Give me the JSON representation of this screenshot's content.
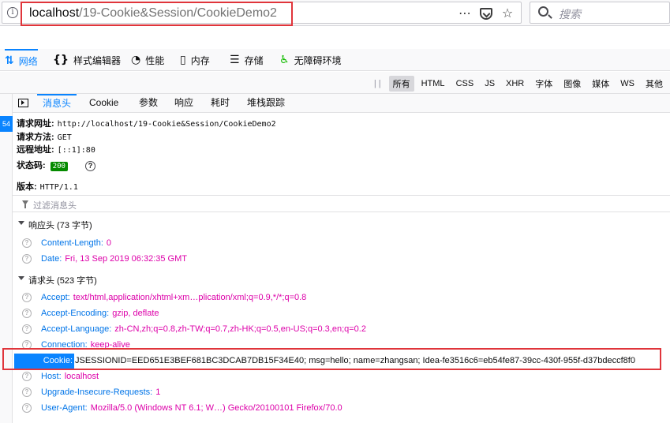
{
  "url_bar": {
    "host": "localhost",
    "path": "/19-Cookie&Session/CookieDemo2",
    "search_placeholder": "搜索",
    "more_icon": "⋯",
    "star_icon": "☆"
  },
  "toolbox": {
    "tabs": [
      {
        "icon": "⇅",
        "label": "网络"
      },
      {
        "icon": "{}",
        "label": "样式编辑器"
      },
      {
        "icon": "◔",
        "label": "性能"
      },
      {
        "icon": "▯",
        "label": "内存"
      },
      {
        "icon": "☰",
        "label": "存储"
      },
      {
        "icon": "♿",
        "label": "无障碍环境"
      }
    ]
  },
  "filters": {
    "pause": "| |",
    "items": [
      "所有",
      "HTML",
      "CSS",
      "JS",
      "XHR",
      "字体",
      "图像",
      "媒体",
      "WS",
      "其他"
    ]
  },
  "request_list": {
    "selected_number": "54"
  },
  "details": {
    "tabs": [
      "消息头",
      "Cookie",
      "参数",
      "响应",
      "耗时",
      "堆栈跟踪"
    ],
    "summary": {
      "url_label": "请求网址:",
      "url_value": "http://localhost/19-Cookie&Session/CookieDemo2",
      "method_label": "请求方法:",
      "method_value": "GET",
      "remote_label": "远程地址:",
      "remote_value": "[::1]:80",
      "status_label": "状态码:",
      "status_value": "200",
      "version_label": "版本:",
      "version_value": "HTTP/1.1"
    },
    "filter_placeholder": "过滤消息头",
    "response_headers": {
      "title": "响应头 (73 字节)",
      "rows": [
        {
          "name": "Content-Length:",
          "value": "0"
        },
        {
          "name": "Date:",
          "value": "Fri, 13 Sep 2019 06:32:35 GMT"
        }
      ]
    },
    "request_headers": {
      "title": "请求头 (523 字节)",
      "rows_before": [
        {
          "name": "Accept:",
          "value": "text/html,application/xhtml+xm…plication/xml;q=0.9,*/*;q=0.8"
        },
        {
          "name": "Accept-Encoding:",
          "value": "gzip, deflate"
        },
        {
          "name": "Accept-Language:",
          "value": "zh-CN,zh;q=0.8,zh-TW;q=0.7,zh-HK;q=0.5,en-US;q=0.3,en;q=0.2"
        },
        {
          "name": "Connection:",
          "value": "keep-alive"
        }
      ],
      "cookie": {
        "name": "Cookie:",
        "value": "JSESSIONID=EED651E3BEF681BC3DCAB7DB15F34E40; msg=hello; name=zhangsan; Idea-fe3516c6=eb54fe87-39cc-430f-955f-d37bdeccf8f0"
      },
      "rows_after": [
        {
          "name": "Host:",
          "value": "localhost"
        },
        {
          "name": "Upgrade-Insecure-Requests:",
          "value": "1"
        },
        {
          "name": "User-Agent:",
          "value": "Mozilla/5.0 (Windows NT 6.1; W…) Gecko/20100101 Firefox/70.0"
        }
      ]
    }
  },
  "colors": {
    "accent": "#0a84ff",
    "header_name": "#0074e8",
    "header_value": "#dd00a9",
    "highlight_box": "#e0353b",
    "status_ok": "#058b00"
  }
}
